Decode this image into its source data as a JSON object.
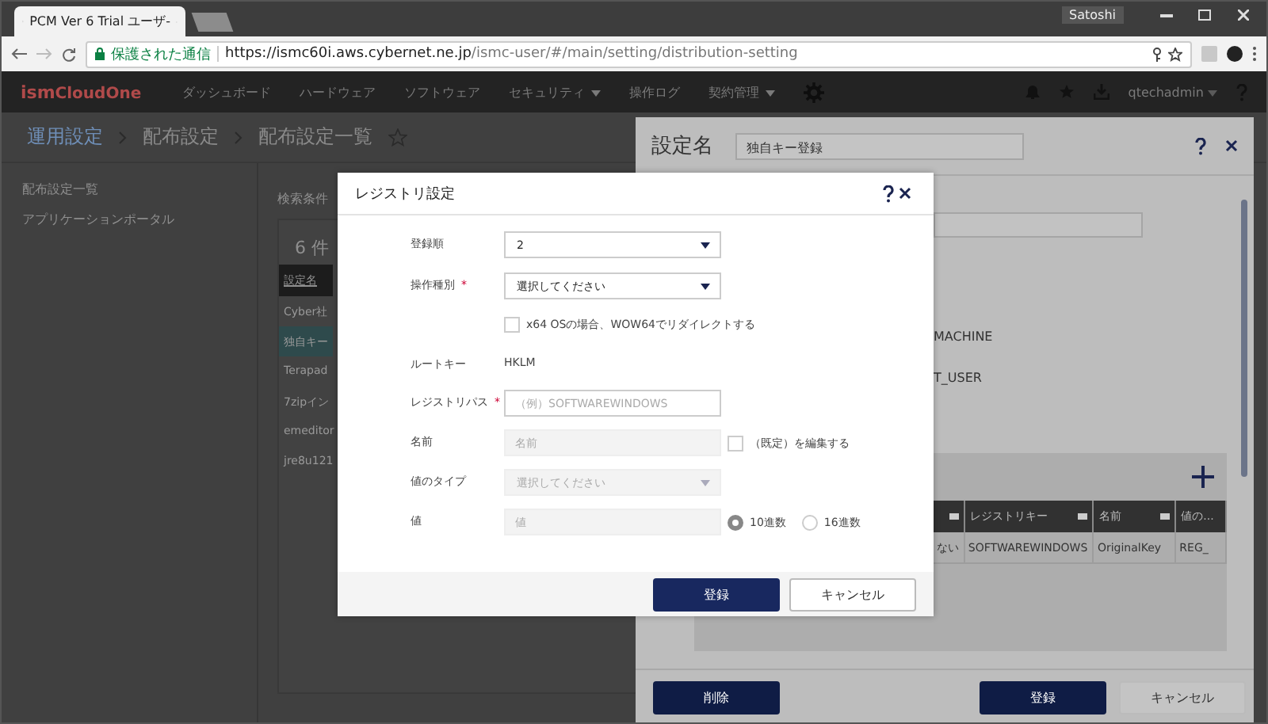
{
  "browser": {
    "tab_title": "PCM Ver 6 Trial ユーザ-",
    "user": "Satoshi",
    "secure_label": "保護された通信",
    "url_host": "https://ismc60i.aws.cybernet.ne.jp",
    "url_path": "/ismc-user/#/main/setting/distribution-setting"
  },
  "navbar": {
    "logo_prefix": "ism",
    "logo_name": "CloudOne",
    "user": "qtechadmin",
    "items": [
      {
        "label": "ダッシュボード",
        "dropdown": false
      },
      {
        "label": "ハードウェア",
        "dropdown": false
      },
      {
        "label": "ソフトウェア",
        "dropdown": false
      },
      {
        "label": "セキュリティ",
        "dropdown": true
      },
      {
        "label": "操作ログ",
        "dropdown": false
      },
      {
        "label": "契約管理",
        "dropdown": true
      }
    ]
  },
  "breadcrumbs": [
    "運用設定",
    "配布設定",
    "配布設定一覧"
  ],
  "sidebar": {
    "items": [
      "配布設定一覧",
      "アプリケーションポータル"
    ]
  },
  "list": {
    "search_label": "検索条件",
    "count": "6 件",
    "column": "設定名",
    "rows": [
      {
        "label": "Cyber社",
        "selected": false
      },
      {
        "label": "独自キー",
        "selected": true
      },
      {
        "label": "Terapad",
        "selected": false
      },
      {
        "label": "7zipイン",
        "selected": false
      },
      {
        "label": "emeditor",
        "selected": false
      },
      {
        "label": "jre8u121",
        "selected": false
      }
    ]
  },
  "panel": {
    "title_label": "設定名",
    "title_value": "独自キー登録",
    "root_keys": [
      "MACHINE",
      "T_USER"
    ],
    "table": {
      "columns": [
        "",
        "レジストリキー",
        "名前",
        "値の..."
      ],
      "rows": [
        [
          "ない",
          "SOFTWAREWINDOWS",
          "OriginalKey",
          "REG_"
        ]
      ]
    },
    "buttons": [
      {
        "label": "削除",
        "kind": "primary"
      },
      {
        "label": "登録",
        "kind": "primary"
      },
      {
        "label": "キャンセル",
        "kind": "secondary"
      }
    ]
  },
  "modal": {
    "title": "レジストリ設定",
    "fields": [
      {
        "kind": "select",
        "label": "登録順",
        "value": "2",
        "disabled": false
      },
      {
        "kind": "select",
        "label": "操作種別",
        "mark": "*",
        "value": "選択してください",
        "disabled": false
      },
      {
        "kind": "checkbox",
        "label": "x64 OSの場合、WOW64でリダイレクトする",
        "checked": false
      },
      {
        "kind": "static",
        "label": "ルートキー",
        "value": "HKLM"
      },
      {
        "kind": "input",
        "label": "レジストリパス",
        "mark": "*",
        "placeholder": "（例）SOFTWAREWINDOWS",
        "disabled": false
      },
      {
        "kind": "input",
        "label": "名前",
        "placeholder": "名前",
        "disabled": true,
        "option": {
          "label": "（既定）を編集する",
          "checked": false
        }
      },
      {
        "kind": "select",
        "label": "値のタイプ",
        "placeholder": "選択してください",
        "disabled": true
      },
      {
        "kind": "input",
        "label": "値",
        "placeholder": "値",
        "disabled": true,
        "radios": [
          {
            "label": "10進数",
            "selected": true
          },
          {
            "label": "16進数",
            "selected": false
          }
        ]
      }
    ],
    "buttons": [
      {
        "label": "登録",
        "kind": "primary"
      },
      {
        "label": "キャンセル",
        "kind": "secondary"
      }
    ]
  }
}
